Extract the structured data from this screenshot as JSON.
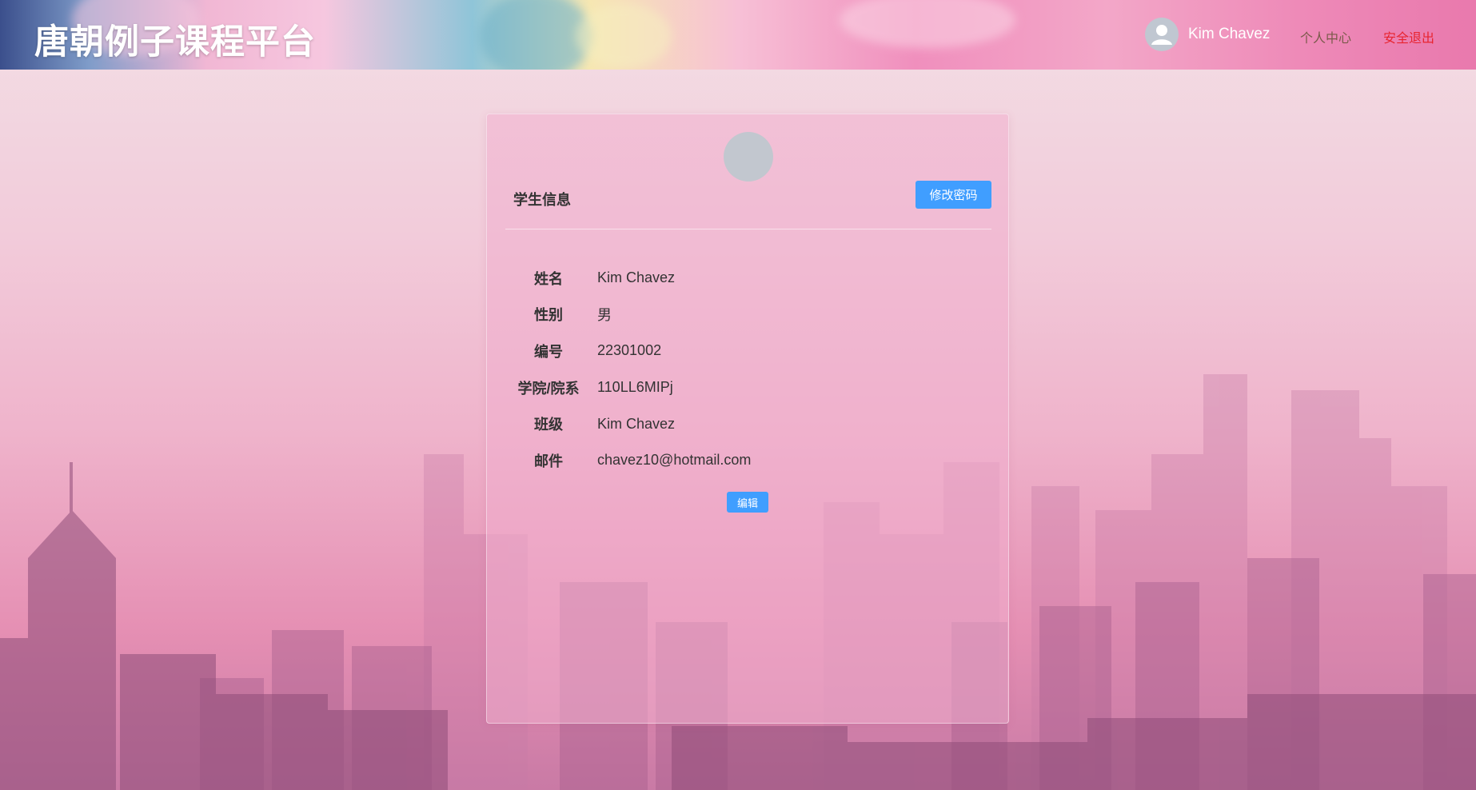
{
  "header": {
    "brand": "唐朝例子课程平台",
    "user_name": "Kim Chavez",
    "nav_center": "个人中心",
    "nav_logout": "安全退出",
    "user_avatar_icon": "user-avatar-icon"
  },
  "card": {
    "title": "学生信息",
    "change_password_label": "修改密码",
    "edit_label": "编辑",
    "fields": [
      {
        "label": "姓名",
        "value": "Kim Chavez"
      },
      {
        "label": "性别",
        "value": "男"
      },
      {
        "label": "编号",
        "value": "22301002"
      },
      {
        "label": "学院/院系",
        "value": "110LL6MIPj"
      },
      {
        "label": "班级",
        "value": "Kim Chavez"
      },
      {
        "label": "邮件",
        "value": "chavez10@hotmail.com"
      }
    ]
  },
  "colors": {
    "primary": "#409eff",
    "logout": "#e8242f"
  }
}
